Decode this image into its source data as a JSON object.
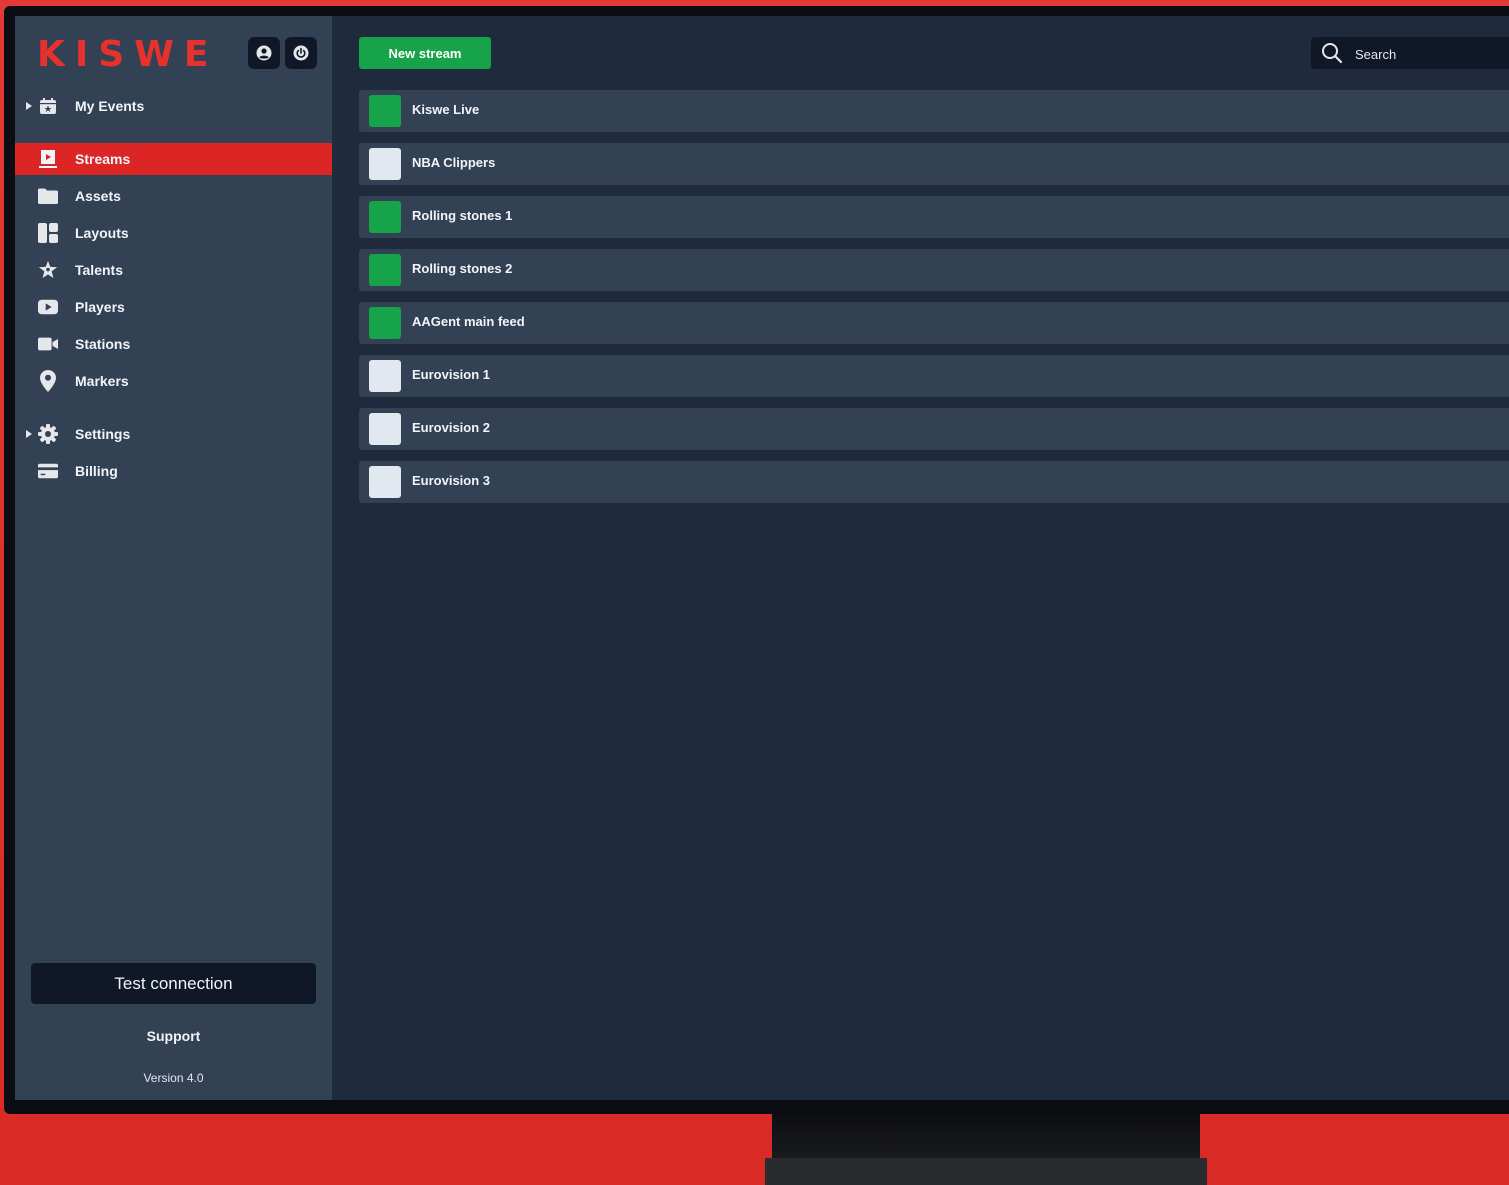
{
  "app": {
    "logo": "KISWE"
  },
  "sidebar": {
    "items": [
      {
        "label": "My Events",
        "icon": "calendar-star-icon",
        "expandable": true
      },
      {
        "label": "Streams",
        "icon": "stream-screen-icon",
        "active": true
      },
      {
        "label": "Assets",
        "icon": "folder-icon"
      },
      {
        "label": "Layouts",
        "icon": "layout-grid-icon"
      },
      {
        "label": "Talents",
        "icon": "star-person-icon"
      },
      {
        "label": "Players",
        "icon": "play-icon"
      },
      {
        "label": "Stations",
        "icon": "video-camera-icon"
      },
      {
        "label": "Markers",
        "icon": "map-pin-icon"
      },
      {
        "label": "Settings",
        "icon": "gear-icon",
        "expandable": true
      },
      {
        "label": "Billing",
        "icon": "credit-card-icon"
      }
    ],
    "test_connection": "Test connection",
    "support": "Support",
    "version": "Version 4.0"
  },
  "header": {
    "new_stream_label": "New stream",
    "search_placeholder": "Search"
  },
  "colors": {
    "active": "#dc2626",
    "live": "#16a34a",
    "idle": "#e2e8f0"
  },
  "streams": [
    {
      "name": "Kiswe Live",
      "status": "live"
    },
    {
      "name": "NBA Clippers",
      "status": "idle"
    },
    {
      "name": "Rolling stones 1",
      "status": "live"
    },
    {
      "name": "Rolling stones 2",
      "status": "live"
    },
    {
      "name": "AAGent main feed",
      "status": "live"
    },
    {
      "name": "Eurovision 1",
      "status": "idle"
    },
    {
      "name": "Eurovision 2",
      "status": "idle"
    },
    {
      "name": "Eurovision 3",
      "status": "idle"
    }
  ]
}
